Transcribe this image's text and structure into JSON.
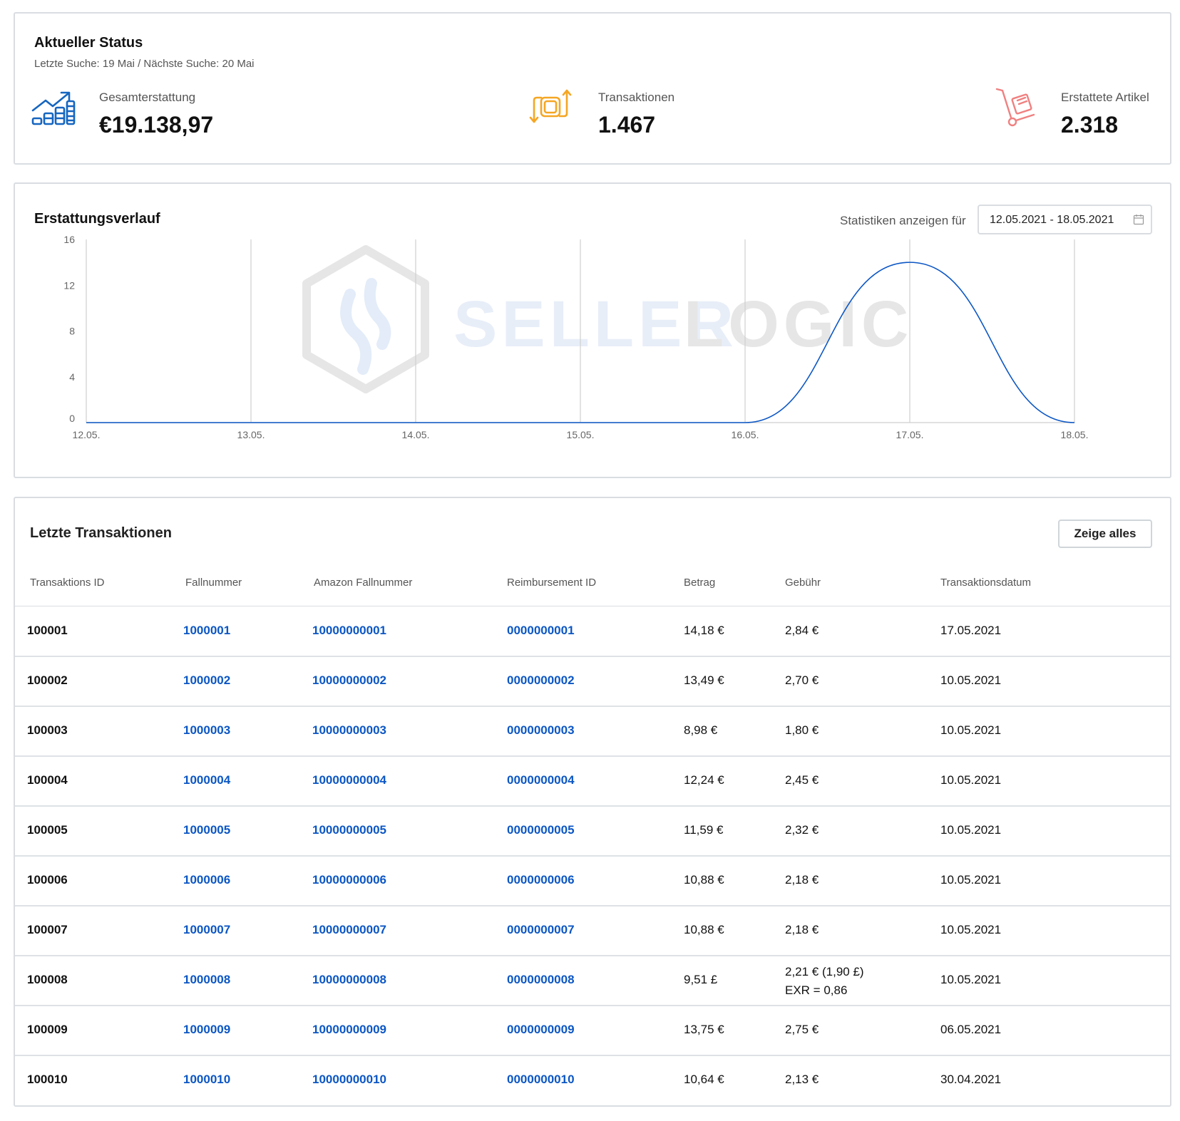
{
  "status": {
    "title": "Aktueller Status",
    "subtitle": "Letzte Suche: 19 Mai / Nächste Suche: 20 Mai",
    "kpis": [
      {
        "label": "Gesamterstattung",
        "value": "€19.138,97",
        "icon": "growth-chart-icon",
        "color": "#1565c0"
      },
      {
        "label": "Transaktionen",
        "value": "1.467",
        "icon": "exchange-arrows-icon",
        "color": "#f5a623"
      },
      {
        "label": "Erstattete Artikel",
        "value": "2.318",
        "icon": "hand-truck-icon",
        "color": "#f08080"
      }
    ]
  },
  "chart": {
    "title": "Erstattungsverlauf",
    "stats_label": "Statistiken anzeigen für",
    "date_range": "12.05.2021 - 18.05.2021",
    "watermark": {
      "left": "SELLER",
      "right": "LOGIC"
    }
  },
  "chart_data": {
    "type": "line",
    "title": "Erstattungsverlauf",
    "x": [
      "12.05.",
      "13.05.",
      "14.05.",
      "15.05.",
      "16.05.",
      "17.05.",
      "18.05."
    ],
    "yticks": [
      0,
      4,
      8,
      12,
      16
    ],
    "ylim": [
      0,
      16
    ],
    "series": [
      {
        "values": [
          0,
          0,
          0,
          0,
          0,
          14,
          0
        ],
        "color": "#0b56c4"
      }
    ],
    "grid": "vertical"
  },
  "transactions": {
    "title": "Letzte Transaktionen",
    "show_all": "Zeige alles",
    "columns": [
      "Transaktions ID",
      "Fallnummer",
      "Amazon Fallnummer",
      "Reimbursement ID",
      "Betrag",
      "Gebühr",
      "Transaktionsdatum"
    ],
    "rows": [
      {
        "id": "100001",
        "case": "1000001",
        "amazon": "10000000001",
        "reimb": "0000000001",
        "amount": "14,18 €",
        "fee": "2,84 €",
        "fee2": "",
        "date": "17.05.2021"
      },
      {
        "id": "100002",
        "case": "1000002",
        "amazon": "10000000002",
        "reimb": "0000000002",
        "amount": "13,49 €",
        "fee": "2,70 €",
        "fee2": "",
        "date": "10.05.2021"
      },
      {
        "id": "100003",
        "case": "1000003",
        "amazon": "10000000003",
        "reimb": "0000000003",
        "amount": "8,98 €",
        "fee": "1,80 €",
        "fee2": "",
        "date": "10.05.2021"
      },
      {
        "id": "100004",
        "case": "1000004",
        "amazon": "10000000004",
        "reimb": "0000000004",
        "amount": "12,24 €",
        "fee": "2,45 €",
        "fee2": "",
        "date": "10.05.2021"
      },
      {
        "id": "100005",
        "case": "1000005",
        "amazon": "10000000005",
        "reimb": "0000000005",
        "amount": "11,59 €",
        "fee": "2,32 €",
        "fee2": "",
        "date": "10.05.2021"
      },
      {
        "id": "100006",
        "case": "1000006",
        "amazon": "10000000006",
        "reimb": "0000000006",
        "amount": "10,88 €",
        "fee": "2,18 €",
        "fee2": "",
        "date": "10.05.2021"
      },
      {
        "id": "100007",
        "case": "1000007",
        "amazon": "10000000007",
        "reimb": "0000000007",
        "amount": "10,88 €",
        "fee": "2,18 €",
        "fee2": "",
        "date": "10.05.2021"
      },
      {
        "id": "100008",
        "case": "1000008",
        "amazon": "10000000008",
        "reimb": "0000000008",
        "amount": "9,51 £",
        "fee": "2,21 € (1,90 £)",
        "fee2": "EXR = 0,86",
        "date": "10.05.2021"
      },
      {
        "id": "100009",
        "case": "1000009",
        "amazon": "10000000009",
        "reimb": "0000000009",
        "amount": "13,75 €",
        "fee": "2,75 €",
        "fee2": "",
        "date": "06.05.2021"
      },
      {
        "id": "100010",
        "case": "1000010",
        "amazon": "10000000010",
        "reimb": "0000000010",
        "amount": "10,64 €",
        "fee": "2,13 €",
        "fee2": "",
        "date": "30.04.2021"
      }
    ]
  }
}
